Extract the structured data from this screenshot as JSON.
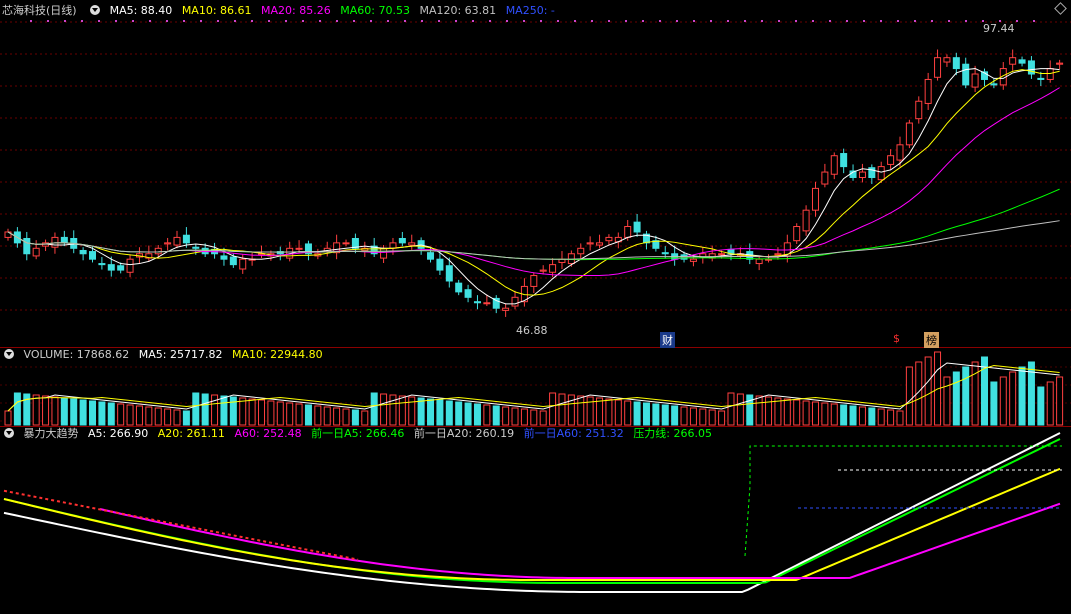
{
  "main": {
    "title": "芯海科技(日线)",
    "ma": [
      {
        "label": "MA5: 88.40",
        "color": "#ffffff"
      },
      {
        "label": "MA10: 86.61",
        "color": "#ffff00"
      },
      {
        "label": "MA20: 85.26",
        "color": "#ff00ff"
      },
      {
        "label": "MA60: 70.53",
        "color": "#00ff00"
      },
      {
        "label": "MA120: 63.81",
        "color": "#c0c0c0"
      },
      {
        "label": "MA250: -",
        "color": "#3050ff"
      }
    ],
    "high_label": "97.44",
    "low_label": "46.88",
    "markers": {
      "cai": "财",
      "s": "$",
      "bang": "榜"
    }
  },
  "volume": {
    "legend": [
      {
        "label": "VOLUME: 17868.62",
        "color": "#cccccc"
      },
      {
        "label": "MA5: 25717.82",
        "color": "#ffffff"
      },
      {
        "label": "MA10: 22944.80",
        "color": "#ffff00"
      }
    ]
  },
  "indicator": {
    "legend": [
      {
        "label": "暴力大趋势",
        "color": "#cccccc"
      },
      {
        "label": "A5: 266.90",
        "color": "#ffffff"
      },
      {
        "label": "A20: 261.11",
        "color": "#ffff00"
      },
      {
        "label": "A60: 252.48",
        "color": "#ff00ff"
      },
      {
        "label": "前一日A5: 266.46",
        "color": "#00ff00"
      },
      {
        "label": "前一日A20: 260.19",
        "color": "#cccccc"
      },
      {
        "label": "前一日A60: 251.32",
        "color": "#3050ff"
      },
      {
        "label": "压力线: 266.05",
        "color": "#00ff00"
      }
    ]
  },
  "chart_data": {
    "type": "candlestick",
    "y_range": [
      44,
      100
    ],
    "close": [
      62,
      60,
      58,
      59,
      60,
      61,
      60,
      59,
      58,
      57,
      56,
      55,
      55,
      57,
      58,
      58,
      59,
      60,
      61,
      60,
      59,
      58,
      58,
      57,
      56,
      57,
      57,
      58,
      58,
      58,
      59,
      59,
      58,
      58,
      59,
      60,
      60,
      59,
      59,
      58,
      59,
      60,
      60,
      60,
      59,
      57,
      55,
      53,
      51,
      50,
      49,
      49,
      48,
      48,
      50,
      52,
      54,
      55,
      56,
      57,
      58,
      59,
      60,
      60,
      61,
      61,
      63,
      62,
      60,
      59,
      58,
      57,
      57,
      57,
      58,
      58,
      58,
      58,
      58,
      57,
      57,
      57,
      58,
      60,
      63,
      66,
      70,
      73,
      76,
      74,
      72,
      73,
      72,
      74,
      76,
      78,
      82,
      86,
      90,
      94,
      94,
      92,
      89,
      91,
      90,
      89,
      92,
      94,
      93,
      91,
      90,
      92,
      93
    ]
  }
}
